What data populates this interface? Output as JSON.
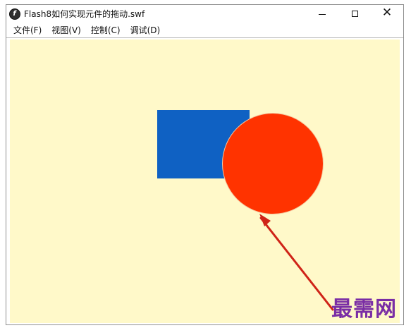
{
  "window": {
    "title": "Flash8如何实现元件的拖动.swf",
    "app_icon_symbol": "f"
  },
  "menu": {
    "items": [
      "文件(F)",
      "视图(V)",
      "控制(C)",
      "调试(D)"
    ]
  },
  "controls": {
    "minimize_icon": "minimize-icon",
    "maximize_icon": "maximize-icon",
    "close_symbol": "✕"
  },
  "stage": {
    "background_color": "#fff9c9",
    "blue_shape_color": "#0f61c3",
    "red_shape_color": "#ff3300",
    "annotation_arrow_color": "#cf2418"
  },
  "watermark": {
    "text": "最需网"
  }
}
